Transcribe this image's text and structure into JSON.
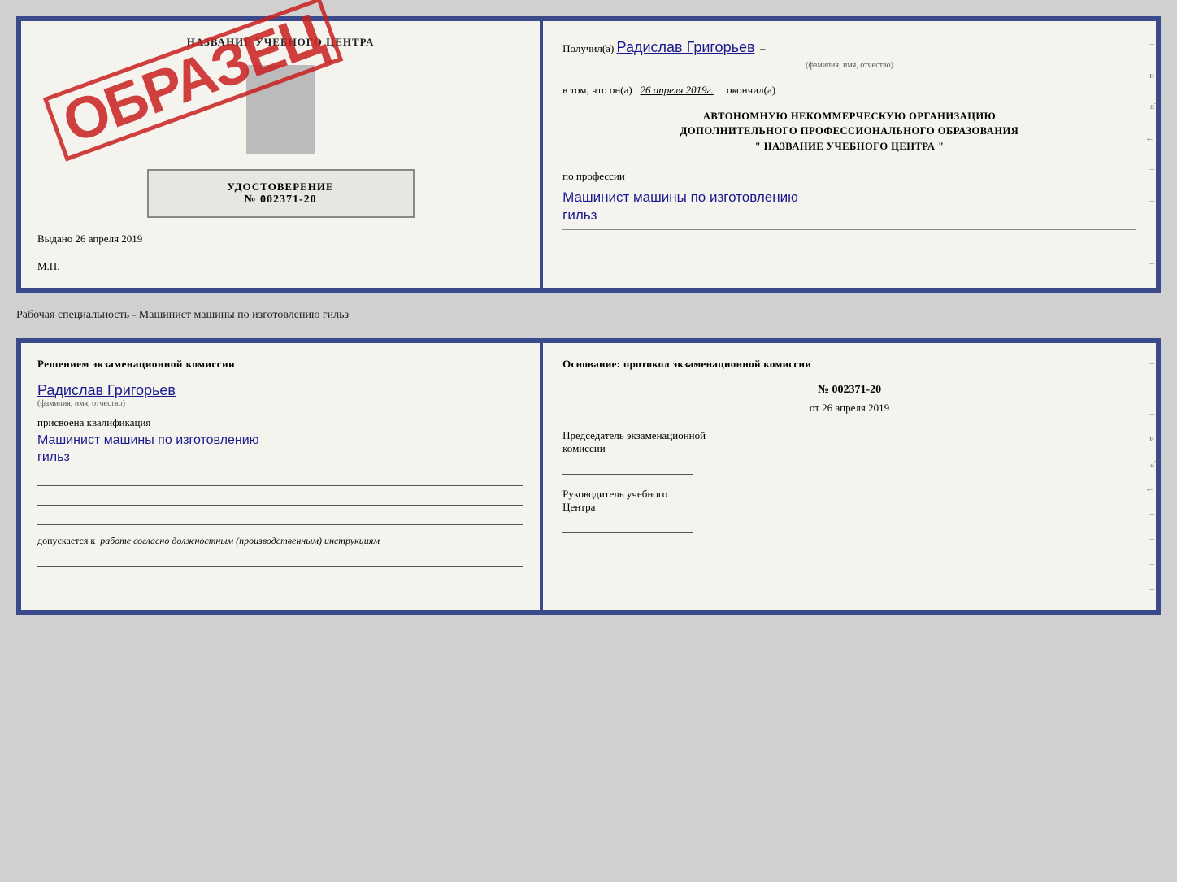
{
  "top_doc": {
    "left": {
      "center_title": "НАЗВАНИЕ УЧЕБНОГО ЦЕНТРА",
      "photo_placeholder": "",
      "cert_title": "УДОСТОВЕРЕНИЕ",
      "cert_number": "№ 002371-20",
      "issued_label": "Выдано",
      "issued_date": "26 апреля 2019",
      "mp_label": "М.П.",
      "stamp_text": "ОБРАЗЕЦ"
    },
    "right": {
      "received_label": "Получил(а)",
      "received_name": "Радислав Григорьев",
      "fio_sublabel": "(фамилия, имя, отчество)",
      "in_that_label": "в том, что он(а)",
      "date_value": "26 апреля 2019г.",
      "finished_label": "окончил(а)",
      "org_line1": "АВТОНОМНУЮ НЕКОММЕРЧЕСКУЮ ОРГАНИЗАЦИЮ",
      "org_line2": "ДОПОЛНИТЕЛЬНОГО ПРОФЕССИОНАЛЬНОГО ОБРАЗОВАНИЯ",
      "org_line3": "\"   НАЗВАНИЕ УЧЕБНОГО ЦЕНТРА   \"",
      "profession_label": "по профессии",
      "profession_name": "Машинист машины по изготовлению",
      "profession_name2": "гильз"
    }
  },
  "specialty_label": "Рабочая специальность - Машинист машины по изготовлению гильз",
  "bottom_doc": {
    "left": {
      "decision_title": "Решением  экзаменационной  комиссии",
      "person_name": "Радислав Григорьев",
      "fio_sublabel": "(фамилия, имя, отчество)",
      "assigned_text": "присвоена квалификация",
      "qualification_name": "Машинист  машины  по  изготовлению",
      "qualification_name2": "гильз",
      "allow_label": "допускается к",
      "allow_text": "работе согласно должностным (производственным) инструкциям"
    },
    "right": {
      "basis_title": "Основание:  протокол  экзаменационной  комиссии",
      "protocol_number": "№  002371-20",
      "protocol_date_prefix": "от",
      "protocol_date": "26 апреля 2019",
      "chairman_label": "Председатель экзаменационной",
      "chairman_label2": "комиссии",
      "head_label": "Руководитель учебного",
      "head_label2": "Центра"
    }
  }
}
